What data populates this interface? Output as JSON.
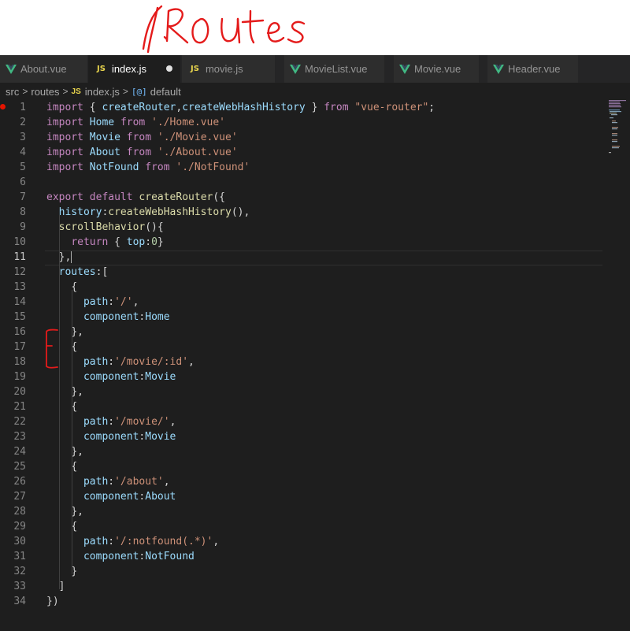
{
  "annotation": {
    "text": "/Routes"
  },
  "tabs": [
    {
      "label": "About.vue",
      "type": "vue",
      "active": false
    },
    {
      "label": "index.js",
      "type": "js",
      "active": true,
      "dirty": true
    },
    {
      "label": "movie.js",
      "type": "js",
      "active": false
    },
    {
      "label": "MovieList.vue",
      "type": "vue",
      "active": false
    },
    {
      "label": "Movie.vue",
      "type": "vue",
      "active": false
    },
    {
      "label": "Header.vue",
      "type": "vue",
      "active": false
    }
  ],
  "icons": {
    "js_badge": "JS",
    "vue": "vue-icon",
    "symbol": "[@]"
  },
  "breadcrumb": {
    "src": "src",
    "routes": "routes",
    "file": "index.js",
    "symbol": "default",
    "sep": ">"
  },
  "colors": {
    "keyword": "#c586c0",
    "string": "#ce9178",
    "variable": "#9cdcfe",
    "function": "#dcdcaa",
    "breakpoint": "#e51400",
    "vue": "#41b883",
    "js": "#e8d44d"
  },
  "editor": {
    "current_line": 11,
    "breakpoint_line": 1,
    "lines": [
      "import { createRouter,createWebHashHistory } from \"vue-router\";",
      "import Home from './Home.vue'",
      "import Movie from './Movie.vue'",
      "import About from './About.vue'",
      "import NotFound from './NotFound'",
      "",
      "export default createRouter({",
      "  history:createWebHashHistory(),",
      "  scrollBehavior(){",
      "    return { top:0}",
      "  },",
      "  routes:[",
      "    {",
      "      path:'/',",
      "      component:Home",
      "    },",
      "    {",
      "      path:'/movie/:id',",
      "      component:Movie",
      "    },",
      "    {",
      "      path:'/movie/',",
      "      component:Movie",
      "    },",
      "    {",
      "      path:'/about',",
      "      component:About",
      "    },",
      "    {",
      "      path:'/:notfound(.*)',",
      "      component:NotFound",
      "    }",
      "  ]",
      "})"
    ]
  }
}
